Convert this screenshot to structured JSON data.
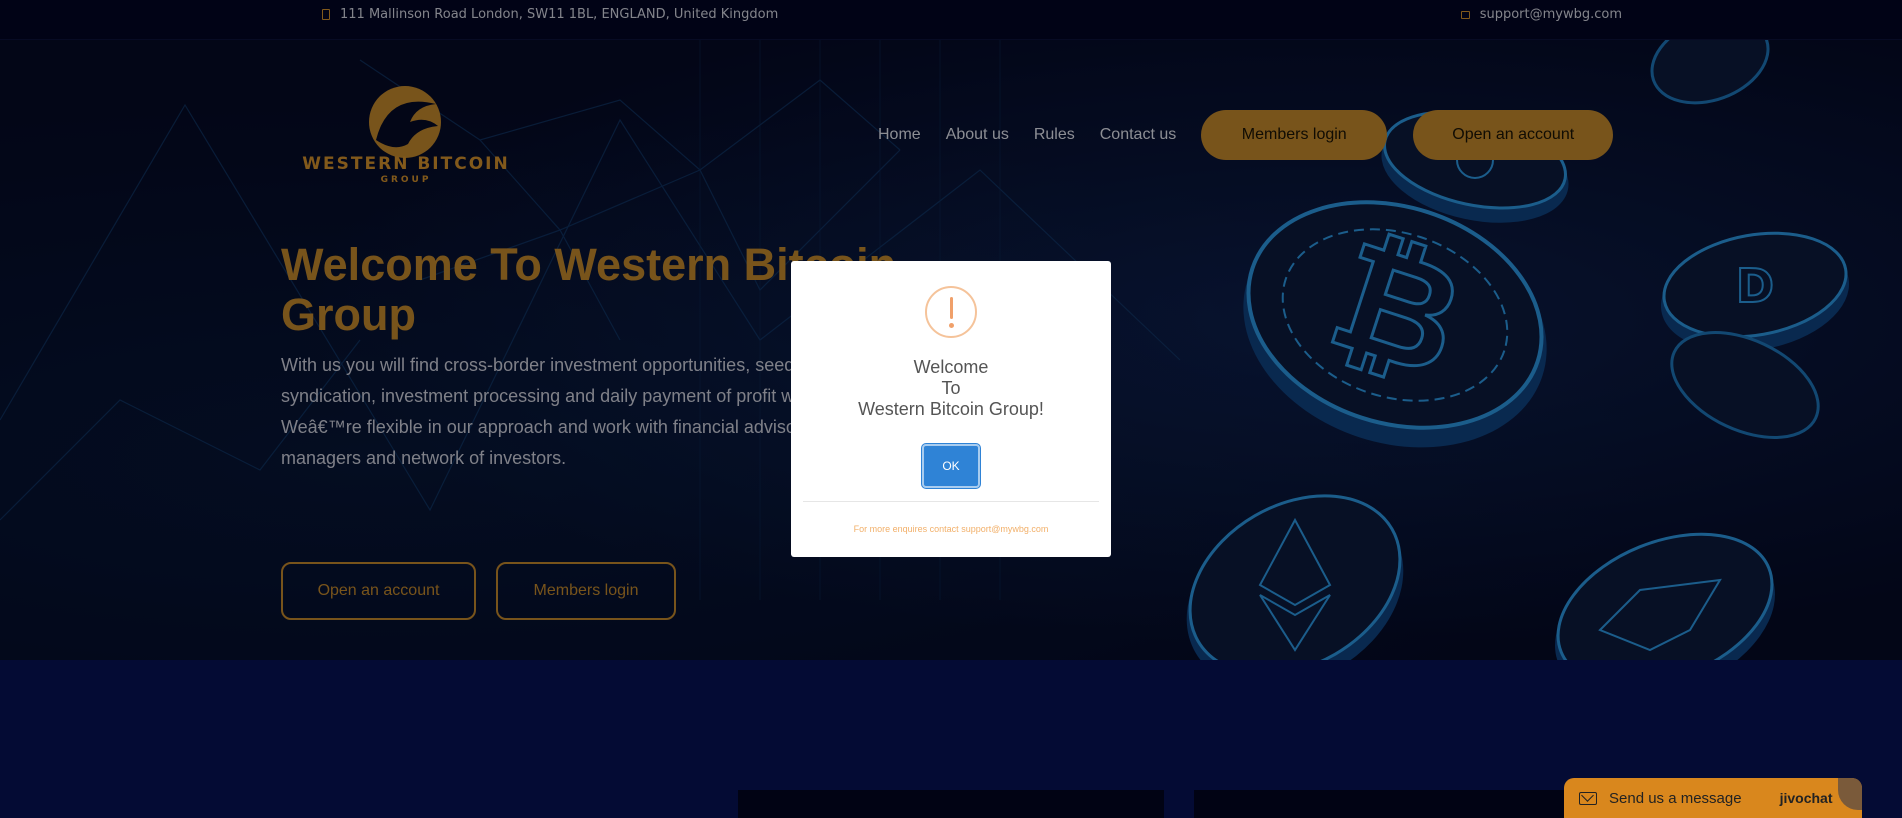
{
  "topbar": {
    "address": "111 Mallinson Road London, SW11 1BL, ENGLAND, United Kingdom",
    "email": "support@mywbg.com"
  },
  "logo": {
    "brand": "WESTERN BITCOIN",
    "sub": "GROUP"
  },
  "nav": {
    "items": [
      "Home",
      "About us",
      "Rules",
      "Contact us"
    ],
    "members_login": "Members login",
    "open_account": "Open an account"
  },
  "hero": {
    "headline": "Welcome To Western Bitcoin Group",
    "lead": "With us you will find cross-border investment opportunities, seed syndication, investment processing and daily payment of profit with Weâ€™re flexible in our approach and work with financial advisors, managers and network of investors.",
    "cta_open": "Open an account",
    "cta_login": "Members login"
  },
  "modal": {
    "title_lines": [
      "Welcome",
      "To",
      "Western Bitcoin Group!"
    ],
    "ok_label": "OK",
    "footer": "For more enquires contact support@mywbg.com"
  },
  "chat": {
    "label": "Send us a message",
    "brand": "jivochat"
  },
  "colors": {
    "gold": "#b8812a",
    "navy": "#050a24",
    "ok_blue": "#2f83d6",
    "chat_orange": "#d9871d"
  },
  "icons": [
    "location-icon",
    "mail-icon",
    "warning-icon",
    "chat-envelope-icon"
  ]
}
